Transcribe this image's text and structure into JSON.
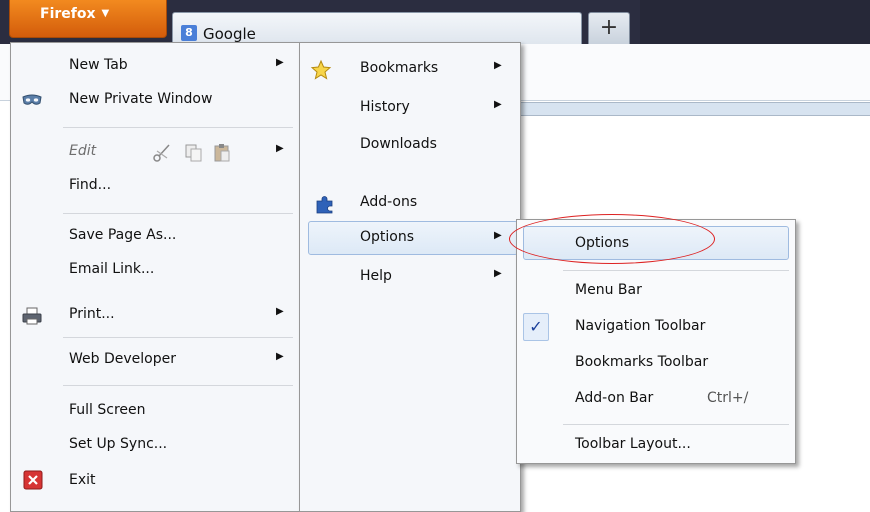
{
  "titlebar": {
    "app_button_label": "Firefox",
    "tab_title": "Google",
    "new_tab_symbol": "+"
  },
  "main_menu": {
    "items": [
      {
        "label": "New Tab",
        "has_submenu": true
      },
      {
        "label": "New Private Window",
        "icon": "private-mask-icon"
      },
      {
        "label": "Edit",
        "disabled": true,
        "icons": [
          "cut-icon",
          "copy-icon",
          "paste-icon"
        ],
        "has_submenu": true
      },
      {
        "label": "Find..."
      },
      {
        "label": "Save Page As..."
      },
      {
        "label": "Email Link..."
      },
      {
        "label": "Print...",
        "icon": "printer-icon",
        "has_submenu": true
      },
      {
        "label": "Web Developer",
        "has_submenu": true
      },
      {
        "label": "Full Screen"
      },
      {
        "label": "Set Up Sync..."
      },
      {
        "label": "Exit",
        "icon": "exit-icon"
      }
    ]
  },
  "secondary_menu": {
    "items": [
      {
        "label": "Bookmarks",
        "icon": "star-icon",
        "has_submenu": true
      },
      {
        "label": "History",
        "has_submenu": true
      },
      {
        "label": "Downloads"
      },
      {
        "label": "Add-ons",
        "icon": "puzzle-icon"
      },
      {
        "label": "Options",
        "has_submenu": true,
        "highlighted": true
      },
      {
        "label": "Help",
        "has_submenu": true
      }
    ]
  },
  "options_submenu": {
    "items": [
      {
        "label": "Options",
        "highlighted": true,
        "circled": true
      },
      {
        "label": "Menu Bar"
      },
      {
        "label": "Navigation Toolbar",
        "checked": true
      },
      {
        "label": "Bookmarks Toolbar"
      },
      {
        "label": "Add-on Bar",
        "shortcut": "Ctrl+/"
      },
      {
        "label": "Toolbar Layout..."
      }
    ]
  },
  "colors": {
    "firefox_orange": "#e8731a",
    "highlight_border": "#9fbbe0",
    "annotation_red": "#dd2222"
  }
}
